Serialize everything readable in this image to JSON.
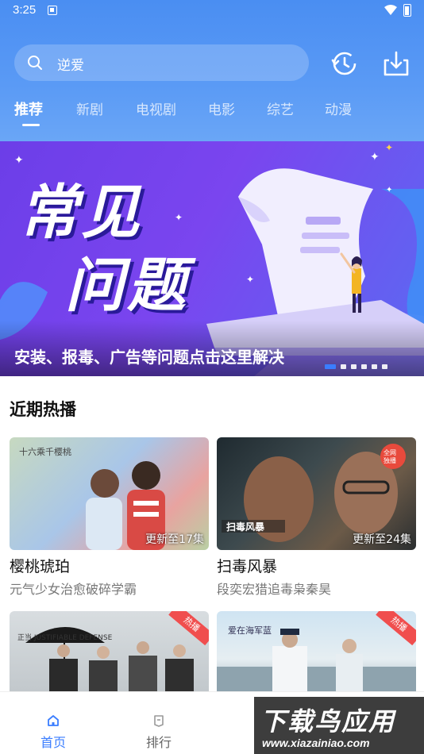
{
  "status_bar": {
    "time": "3:25"
  },
  "search": {
    "query": "逆爱"
  },
  "icons": {
    "history": "history-icon",
    "download": "download-icon",
    "search": "search-icon"
  },
  "tabs": [
    {
      "label": "推荐",
      "active": true
    },
    {
      "label": "新剧"
    },
    {
      "label": "电视剧"
    },
    {
      "label": "电影"
    },
    {
      "label": "综艺"
    },
    {
      "label": "动漫"
    }
  ],
  "banner": {
    "title_line1": "常见",
    "title_line2": "问题",
    "caption": "安装、报毒、广告等问题点击这里解决",
    "slide_count": 6,
    "active_slide": 1
  },
  "section": {
    "title": "近期热播"
  },
  "cards": [
    {
      "title": "樱桃琥珀",
      "subtitle": "元气少女治愈破碎学霸",
      "update": "更新至17集"
    },
    {
      "title": "扫毒风暴",
      "subtitle": "段奕宏猎追毒枭秦昊",
      "update": "更新至24集"
    },
    {
      "title": "",
      "subtitle": "",
      "update": "",
      "badge": "热播"
    },
    {
      "title": "",
      "subtitle": "",
      "update": "",
      "badge": "热播"
    }
  ],
  "bottom_nav": [
    {
      "label": "首页",
      "active": true
    },
    {
      "label": "排行"
    }
  ],
  "watermark": {
    "big": "下载鸟应用",
    "small": "www.xiazainiao.com"
  },
  "colors": {
    "accent": "#3a7dff",
    "header": "#4a8ef2",
    "banner": "#6c3ee8",
    "badge": "#f04e4e"
  }
}
